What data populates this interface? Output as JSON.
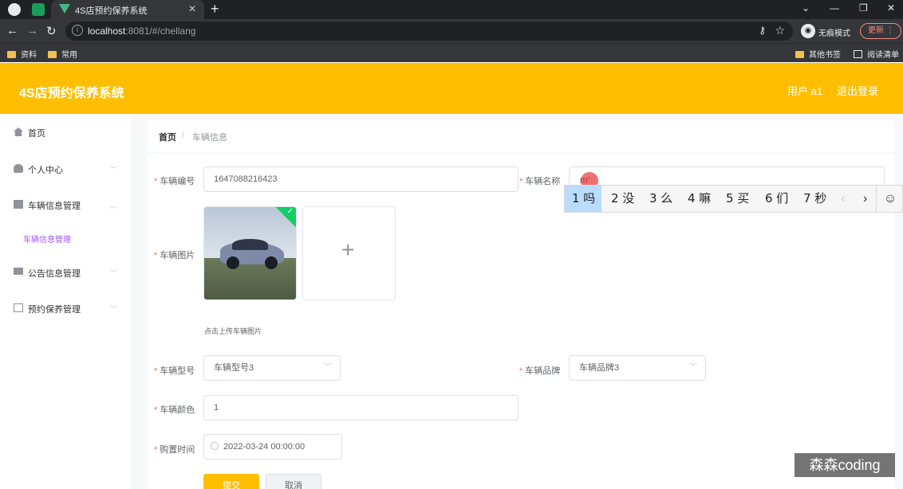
{
  "browser": {
    "tab_title": "4S店预约保养系统",
    "url_host": "localhost",
    "url_path": ":8081/#/chellang",
    "incognito_label": "无痕模式",
    "update_label": "更新",
    "bookmarks": [
      "资料",
      "常用"
    ],
    "bookmarks_right": [
      "其他书签",
      "阅读清单"
    ]
  },
  "header": {
    "title": "4S店预约保养系统",
    "user": "用户 a1",
    "logout": "退出登录",
    "bg_color": "#ffbf00"
  },
  "sidebar": {
    "items": [
      {
        "label": "首页",
        "icon": "home-icon"
      },
      {
        "label": "个人中心",
        "icon": "user-icon"
      },
      {
        "label": "车辆信息管理",
        "icon": "car-icon"
      },
      {
        "label": "公告信息管理",
        "icon": "monitor-icon"
      },
      {
        "label": "预约保养管理",
        "icon": "copy-icon"
      }
    ],
    "sub_item": "车辆信息管理"
  },
  "breadcrumb": {
    "home": "首页",
    "separator": "/",
    "current": "车辆信息"
  },
  "form": {
    "vehicle_no_label": "车辆编号",
    "vehicle_no_value": "1647088216423",
    "vehicle_name_label": "车辆名称",
    "vehicle_name_value": "",
    "vehicle_image_label": "车辆图片",
    "upload_tip": "点击上传车辆图片",
    "model_label": "车辆型号",
    "model_value": "车辆型号3",
    "brand_label": "车辆品牌",
    "brand_value": "车辆品牌3",
    "color_label": "车辆颜色",
    "color_value": "1",
    "purchase_label": "购置时间",
    "purchase_value": "2022-03-24 00:00:00",
    "submit": "提交",
    "cancel": "取消"
  },
  "ime": {
    "typed": "m'",
    "candidates": [
      "1 吗",
      "2 没",
      "3 么",
      "4 嘛",
      "5 买",
      "6 们",
      "7 秒"
    ]
  },
  "watermark": "森森coding"
}
